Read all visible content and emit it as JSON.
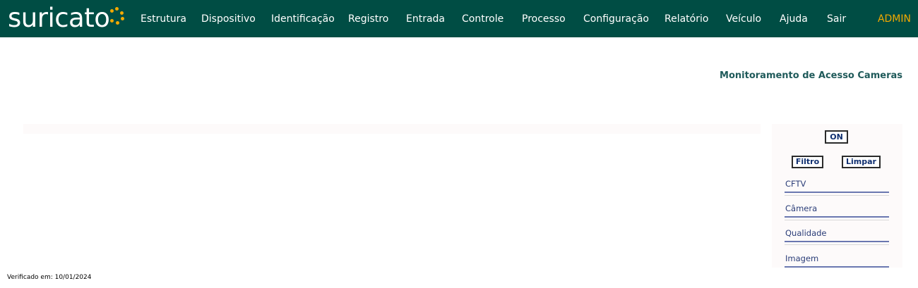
{
  "brand": {
    "logo_text": "suricato",
    "accent_color": "#f2a900",
    "header_color": "#004d44"
  },
  "nav": {
    "items": [
      {
        "label": "Estrutura"
      },
      {
        "label": "Dispositivo"
      },
      {
        "label": "Identificação"
      },
      {
        "label": "Registro"
      },
      {
        "label": "Entrada"
      },
      {
        "label": "Controle"
      },
      {
        "label": "Processo"
      },
      {
        "label": "Configuração"
      },
      {
        "label": "Relatório"
      },
      {
        "label": "Veículo"
      },
      {
        "label": "Ajuda"
      },
      {
        "label": "Sair"
      }
    ],
    "user": "ADMIN"
  },
  "page": {
    "title": "Monitoramento de Acesso Cameras"
  },
  "panel": {
    "on_label": "ON",
    "filter_label": "Filtro",
    "clear_label": "Limpar",
    "fields": [
      {
        "label": "CFTV"
      },
      {
        "label": "Câmera"
      },
      {
        "label": "Qualidade"
      },
      {
        "label": "Imagem"
      }
    ]
  },
  "footer": {
    "verified": "Verificado em: 10/01/2024"
  }
}
